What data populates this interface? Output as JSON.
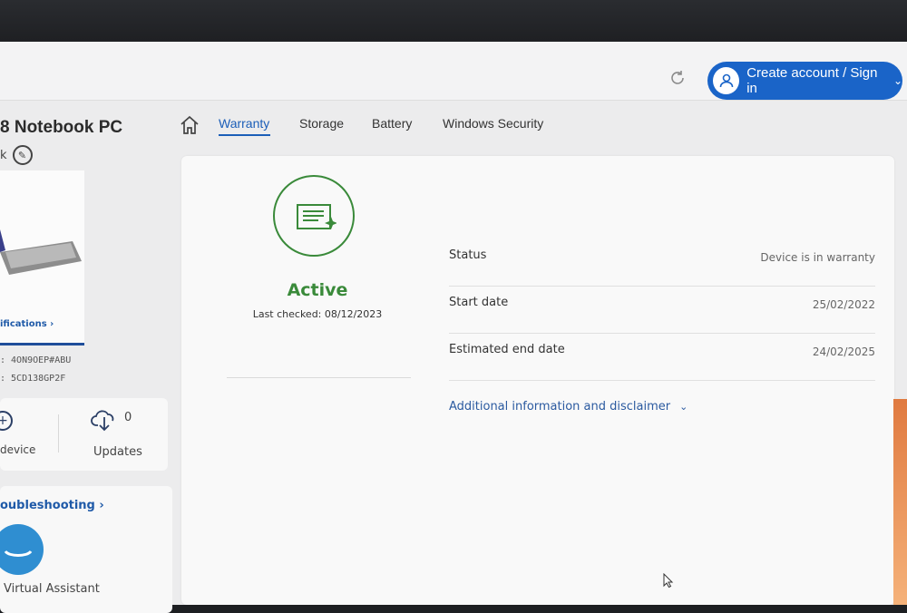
{
  "header": {
    "signin_label": "Create account / Sign in",
    "signin_chevron": "⌄"
  },
  "device": {
    "title": "8 Notebook PC",
    "subtitle": "k",
    "specs_link": "ifications ›",
    "product_number": ": 4ON9OEP#ABU",
    "serial_number": ": 5CD138GP2F"
  },
  "actions": {
    "add_device_label": "device",
    "updates_label": "Updates",
    "updates_count": "0"
  },
  "support": {
    "troubleshooting_link": "oubleshooting ›",
    "assistant_label": "Virtual Assistant"
  },
  "tabs": [
    {
      "label": "Warranty",
      "active": true
    },
    {
      "label": "Storage",
      "active": false
    },
    {
      "label": "Battery",
      "active": false
    },
    {
      "label": "Windows Security",
      "active": false
    }
  ],
  "warranty": {
    "state": "Active",
    "last_checked": "Last checked: 08/12/2023",
    "rows": [
      {
        "label": "Status",
        "value": "Device is in warranty"
      },
      {
        "label": "Start date",
        "value": "25/02/2022"
      },
      {
        "label": "Estimated end date",
        "value": "24/02/2025"
      }
    ],
    "disclaimer_link": "Additional information and disclaimer",
    "disclaimer_chevron": "⌄"
  },
  "colors": {
    "accent_blue": "#1a64c8",
    "active_green": "#3a8a3a"
  }
}
